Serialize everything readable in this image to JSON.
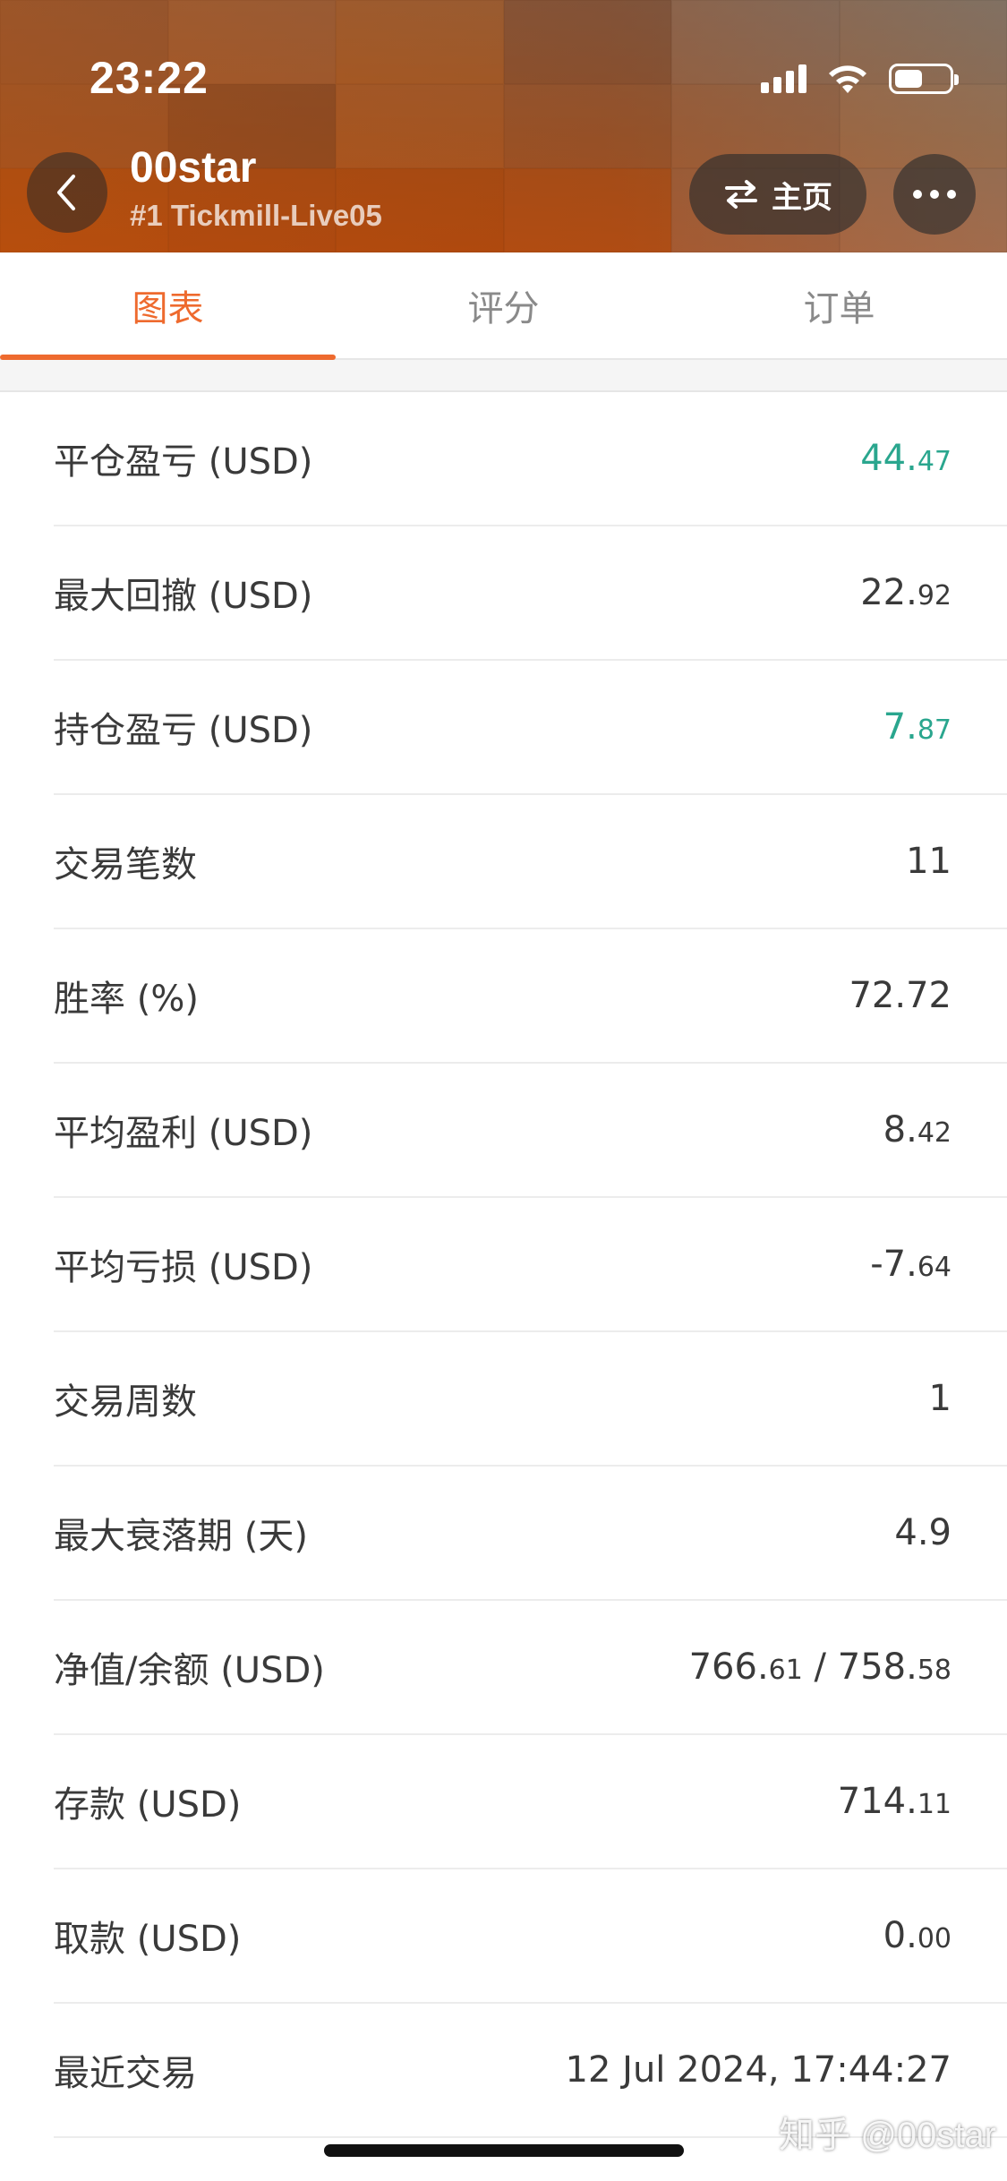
{
  "status_bar": {
    "time": "23:22"
  },
  "header": {
    "title": "00star",
    "subtitle": "#1 Tickmill-Live05",
    "home_label": "主页"
  },
  "tabs": [
    {
      "label": "图表",
      "active": true
    },
    {
      "label": "评分",
      "active": false
    },
    {
      "label": "订单",
      "active": false
    }
  ],
  "stats": [
    {
      "label": "平仓盈亏 (USD)",
      "value_main": "44.",
      "value_dec": "47",
      "positive": true
    },
    {
      "label": "最大回撤 (USD)",
      "value_main": "22.",
      "value_dec": "92",
      "positive": false
    },
    {
      "label": "持仓盈亏 (USD)",
      "value_main": "7.",
      "value_dec": "87",
      "positive": true
    },
    {
      "label": "交易笔数",
      "value_main": "11",
      "value_dec": "",
      "positive": false
    },
    {
      "label": "胜率 (%)",
      "value_main": "72.72",
      "value_dec": "",
      "positive": false
    },
    {
      "label": "平均盈利 (USD)",
      "value_main": "8.",
      "value_dec": "42",
      "positive": false
    },
    {
      "label": "平均亏损 (USD)",
      "value_main": "-7.",
      "value_dec": "64",
      "positive": false
    },
    {
      "label": "交易周数",
      "value_main": "1",
      "value_dec": "",
      "positive": false
    },
    {
      "label": "最大衰落期 (天)",
      "value_main": "4.9",
      "value_dec": "",
      "positive": false
    },
    {
      "label": "净值/余额 (USD)",
      "value_main": "766.",
      "value_dec": "61",
      "value_main2": " / 758.",
      "value_dec2": "58",
      "positive": false
    },
    {
      "label": "存款 (USD)",
      "value_main": "714.",
      "value_dec": "11",
      "positive": false
    },
    {
      "label": "取款 (USD)",
      "value_main": "0.",
      "value_dec": "00",
      "positive": false
    },
    {
      "label": "最近交易",
      "value_main": "12 Jul 2024, 17:44:27",
      "value_dec": "",
      "positive": false
    }
  ],
  "watermark": "知乎 @00star",
  "colors": {
    "accent": "#ee6a2e",
    "positive": "#2aa68e"
  }
}
